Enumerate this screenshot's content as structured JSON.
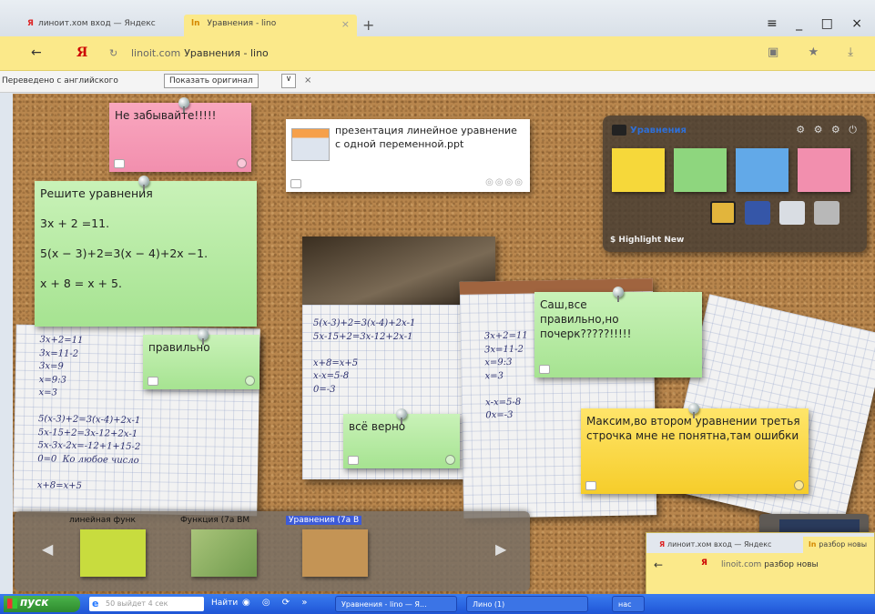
{
  "browser": {
    "tabs": [
      {
        "label": "линоит.хом вход — Яндекс",
        "active": false
      },
      {
        "label": "Уравнения - lino",
        "active": true
      }
    ],
    "new_tab": "+",
    "window_controls": "≡ _ □ ×",
    "back": "←",
    "yandex_logo": "Я",
    "reload": "↻",
    "url_domain": "linoit.com",
    "url_title": "Уравнения - lino",
    "addr_icons": "▣ ★ ⤓",
    "translation_label": "Переведено с английского",
    "show_original": "Показать оригинал",
    "trans_dropdown": "∨",
    "trans_close": "×"
  },
  "board": {
    "stickies": {
      "reminder": "Не забывайте!!!!!",
      "presentation": "презентация линейное уравнение с одной переменной.ppt",
      "task_title": "Решите уравнения",
      "task_eq1": "3х + 2 =11.",
      "task_eq2": "5(х − 3)+2=3(х − 4)+2х −1.",
      "task_eq3": "х + 8 = х + 5.",
      "correct1": "правильно",
      "correct2": "всё верно",
      "sasha": "Саш,все правильно,но почерк?????!!!!!",
      "maxim": "Максим,во втором уравнении третья строчка мне не понятна,там ошибки"
    },
    "handwriting": {
      "left": "3х+2=11\n3х=11-2\n3х=9\nх=9:3\nх=3\n\n5(х-3)+2=3(х-4)+2х-1\n5х-15+2=3х-12+2х-1\n5х-3х-2х=-12+1+15-2\n0=0  Ко любое число\n\nх+8=х+5",
      "middle": "5(х-3)+2=3(х-4)+2х-1\n5х-15+2=3х-12+2х-1\n\nх+8=х+5\nх-х=5-8\n0=-3",
      "right": "3х+2=11\n3х=11-2\nх=9:3\nх=3\n\nх-х=5-8\n0х=-3"
    },
    "palette": {
      "title": "Уравнения",
      "controls": "⚙ ⚙ ⚙ ⏻",
      "highlight": "Highlight New",
      "swatch_colors": [
        "#f6d83a",
        "#8ed67e",
        "#62a9e8",
        "#f28fae"
      ]
    },
    "navigator": {
      "tabs": [
        "линейная функ",
        "Функция (7а ВМ",
        "Уравнения (7а В"
      ],
      "active_tab": 2,
      "prev": "◀",
      "next": "▶"
    }
  },
  "taskbar": {
    "start": "пуск",
    "search_placeholder": "50 выйдет 4 сек",
    "find": "Найти",
    "quick_icons": "◉ ◎ ⟳ »",
    "items": [
      "Уравнения - lino — Я...",
      "Лино (1)",
      "нас"
    ]
  },
  "preview_window": {
    "tab1": "линоит.хом вход — Яндекс",
    "tab2": "разбор новы",
    "back": "←",
    "yandex_logo": "Я",
    "url_domain": "linoit.com",
    "url_title": "разбор новы"
  },
  "colors": {
    "tab_active": "#fbe98a",
    "cork": "#b8864d",
    "pink_note": "#f28fae",
    "green_note": "#a6e391",
    "yellow_note": "#f6cd2a",
    "active_nav": "#3d5bd8",
    "taskbar": "#1f55d6"
  }
}
